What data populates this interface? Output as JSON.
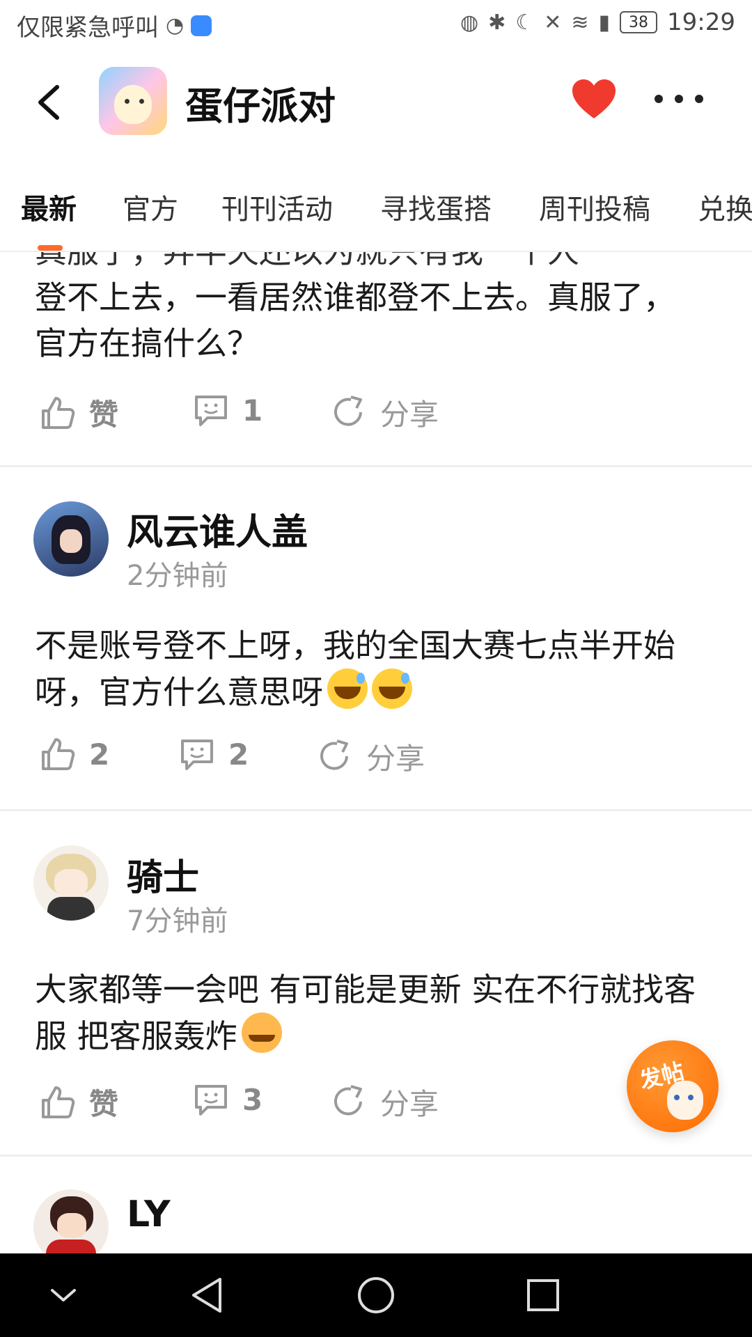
{
  "status_bar": {
    "left_text": "仅限紧急呼叫",
    "battery": "38",
    "time": "19:29"
  },
  "header": {
    "title": "蛋仔派对"
  },
  "tabs": [
    {
      "label": "最新",
      "active": true
    },
    {
      "label": "官方",
      "active": false
    },
    {
      "label": "刊刊活动",
      "active": false
    },
    {
      "label": "寻找蛋搭",
      "active": false
    },
    {
      "label": "周刊投稿",
      "active": false
    },
    {
      "label": "兑换",
      "active": false
    }
  ],
  "posts": [
    {
      "content_partial": "真服了，弄半天还以为就只有我一个人",
      "content": "登不上去，一看居然谁都登不上去。真服了，官方在搞什么？",
      "like_label": "赞",
      "comment_count": "1",
      "share_label": "分享"
    },
    {
      "username": "风云谁人盖",
      "time": "2分钟前",
      "content": "不是账号登不上呀，我的全国大赛七点半开始呀，官方什么意思呀",
      "like_label": "2",
      "comment_count": "2",
      "share_label": "分享"
    },
    {
      "username": "骑士",
      "time": "7分钟前",
      "content": "大家都等一会吧 有可能是更新 实在不行就找客服 把客服轰炸",
      "like_label": "赞",
      "comment_count": "3",
      "share_label": "分享"
    },
    {
      "username": "LY"
    }
  ],
  "fab": {
    "label": "发帖"
  },
  "colors": {
    "accent": "#ff6a2a",
    "heart": "#f03a2e",
    "muted": "#999999"
  },
  "icons": [
    "back-arrow-icon",
    "heart-icon",
    "more-icon",
    "thumbs-up-icon",
    "comment-icon",
    "share-icon",
    "nav-back-icon",
    "nav-home-icon",
    "nav-recents-icon",
    "nav-collapse-icon"
  ]
}
